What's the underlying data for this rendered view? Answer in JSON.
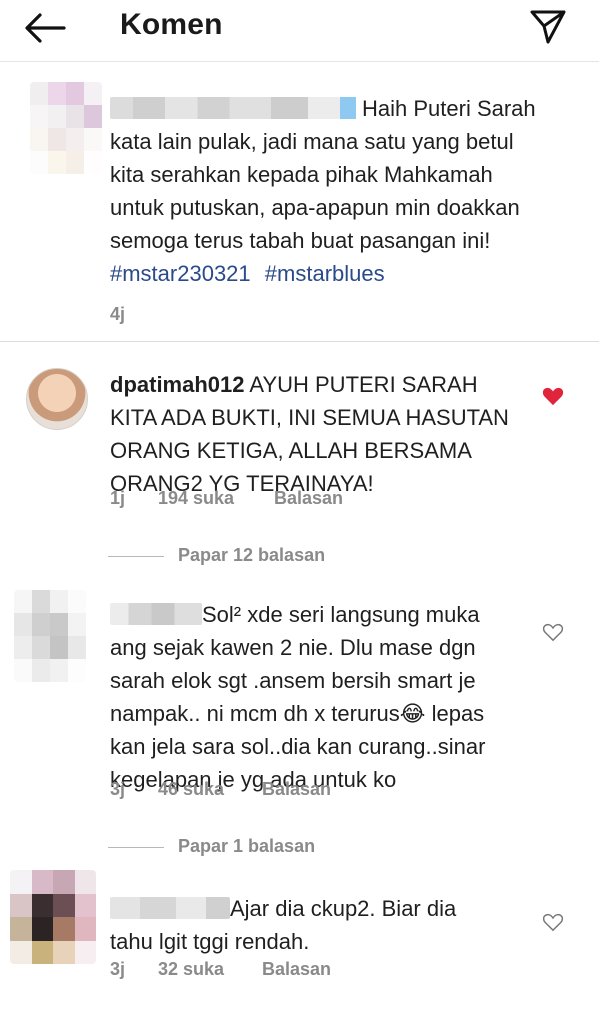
{
  "header": {
    "title": "Komen"
  },
  "caption": {
    "text": "Haih Puteri Sarah kata lain pulak, jadi mana satu yang betul kita serahkan kepada pihak Mahkamah untuk putuskan, apa-apapun min doakkan semoga terus tabah buat pasangan ini!",
    "lines": [
      "Haih Puteri Sarah",
      "kata lain pulak, jadi mana satu yang betul",
      "kita serahkan kepada pihak Mahkamah",
      "untuk putuskan, apa-apapun min doakkan",
      "semoga terus tabah buat pasangan ini!"
    ],
    "hashtags": [
      "#mstar230321",
      "#mstarblues"
    ],
    "time": "4j"
  },
  "comments": [
    {
      "username": "dpatimah012",
      "lines": [
        "AYUH PUTERI SARAH",
        "KITA ADA BUKTI, INI SEMUA HASUTAN",
        "ORANG KETIGA, ALLAH BERSAMA",
        "ORANG2 YG TERAINAYA!"
      ],
      "time": "1j",
      "likes": "194 suka",
      "reply_label": "Balasan",
      "liked": true,
      "view_replies": "Papar 12 balasan"
    },
    {
      "username": "",
      "lines": [
        "Sol² xde seri langsung muka",
        "ang sejak kawen 2 nie. Dlu mase dgn",
        "sarah elok sgt .ansem bersih smart je",
        "nampak.. ni mcm dh x terurus😂 lepas",
        "kan jela sara sol..dia kan curang..sinar",
        "kegelapan je yg ada untuk ko"
      ],
      "time": "3j",
      "likes": "46 suka",
      "reply_label": "Balasan",
      "liked": false,
      "view_replies": "Papar 1 balasan"
    },
    {
      "username": "",
      "lines": [
        "Ajar dia ckup2. Biar dia",
        "tahu lgit tggi rendah."
      ],
      "time": "3j",
      "likes": "32 suka",
      "reply_label": "Balasan",
      "liked": false
    }
  ],
  "icons": {
    "back": "arrow-left-icon",
    "send": "paper-plane-icon",
    "liked_heart": "heart-filled-icon",
    "heart": "heart-outline-icon"
  },
  "colors": {
    "liked_heart": "#e0243c",
    "hashtag": "#2b4a8a",
    "meta": "#8a8a8a"
  }
}
